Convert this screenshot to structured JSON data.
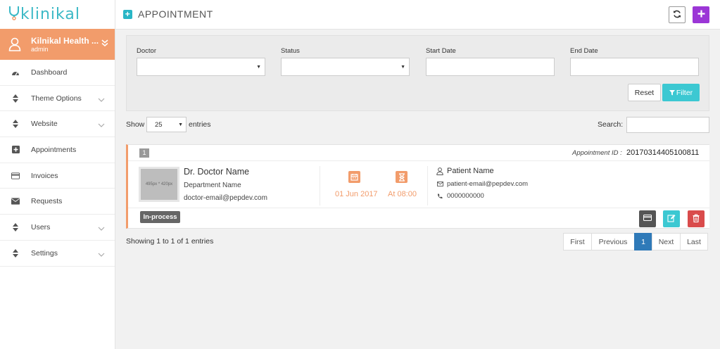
{
  "brand": {
    "logo_text": "klinikal",
    "accent": "#3cb9c6",
    "sidebar_accent": "#f29c6b"
  },
  "profile": {
    "name": "Kilnikal Health ...",
    "role": "admin"
  },
  "sidebar": {
    "items": [
      {
        "label": "Dashboard",
        "icon": "dashboard-icon",
        "has_children": false
      },
      {
        "label": "Theme Options",
        "icon": "sort-icon",
        "has_children": true
      },
      {
        "label": "Website",
        "icon": "sort-icon",
        "has_children": true
      },
      {
        "label": "Appointments",
        "icon": "plus-square-icon",
        "has_children": false
      },
      {
        "label": "Invoices",
        "icon": "credit-card-icon",
        "has_children": false
      },
      {
        "label": "Requests",
        "icon": "envelope-icon",
        "has_children": false
      },
      {
        "label": "Users",
        "icon": "sort-icon",
        "has_children": true
      },
      {
        "label": "Settings",
        "icon": "sort-icon",
        "has_children": true
      }
    ]
  },
  "header": {
    "title": "APPOINTMENT"
  },
  "filters": {
    "doctor_label": "Doctor",
    "doctor_value": "",
    "status_label": "Status",
    "status_value": "",
    "start_date_label": "Start Date",
    "end_date_label": "End Date",
    "reset_label": "Reset",
    "filter_label": "Filter"
  },
  "table_controls": {
    "show_label": "Show",
    "entries_value": "25",
    "entries_label": "entries",
    "search_label": "Search:"
  },
  "appointments": [
    {
      "index": "1",
      "id_label": "Appointment ID :",
      "id_value": "20170314405100811",
      "doctor_image_placeholder": "495px * 420px",
      "doctor_name": "Dr. Doctor Name",
      "department": "Department Name",
      "doctor_email": "doctor-email@pepdev.com",
      "date": "01 Jun 2017",
      "time": "At 08:00",
      "patient_name": "Patient Name",
      "patient_email": "patient-email@pepdev.com",
      "patient_phone": "0000000000",
      "status": "In-process"
    }
  ],
  "footer": {
    "showing_text": "Showing 1 to 1 of 1 entries",
    "pagination": [
      "First",
      "Previous",
      "1",
      "Next",
      "Last"
    ]
  }
}
